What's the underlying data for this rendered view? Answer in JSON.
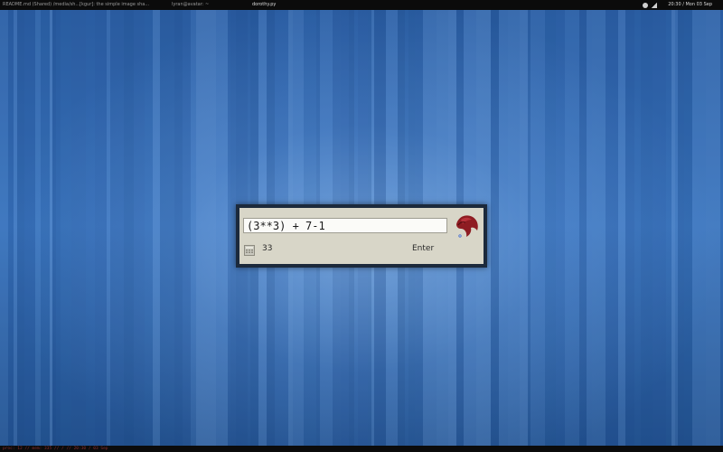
{
  "topbar": {
    "tasks": [
      {
        "label": "README.md (Shared) /media/sh...",
        "active": false
      },
      {
        "label": "[kgur]: the simple image sha...",
        "active": false
      },
      {
        "label": "lyran@avatar: ~",
        "active": false
      },
      {
        "label": "dorothy.py",
        "active": true
      }
    ],
    "clock": "20:30 / Mon 03 Sep"
  },
  "bottombar": {
    "status": "proc: 12   //   mem: 335   //   /   //   20:30 / 03 Sep"
  },
  "launcher": {
    "query": "(3**3) + 7-1",
    "result": "33",
    "action_label": "Enter",
    "result_icon": "calculator-icon",
    "logo_icon": "red-bird-logo-icon"
  },
  "colors": {
    "desktop_blue": "#2f68b0",
    "panel_bg": "#d8d6c8",
    "frame": "#1c2a3c",
    "bar_bg": "#0b0b0b",
    "logo_red": "#8e1c22"
  }
}
